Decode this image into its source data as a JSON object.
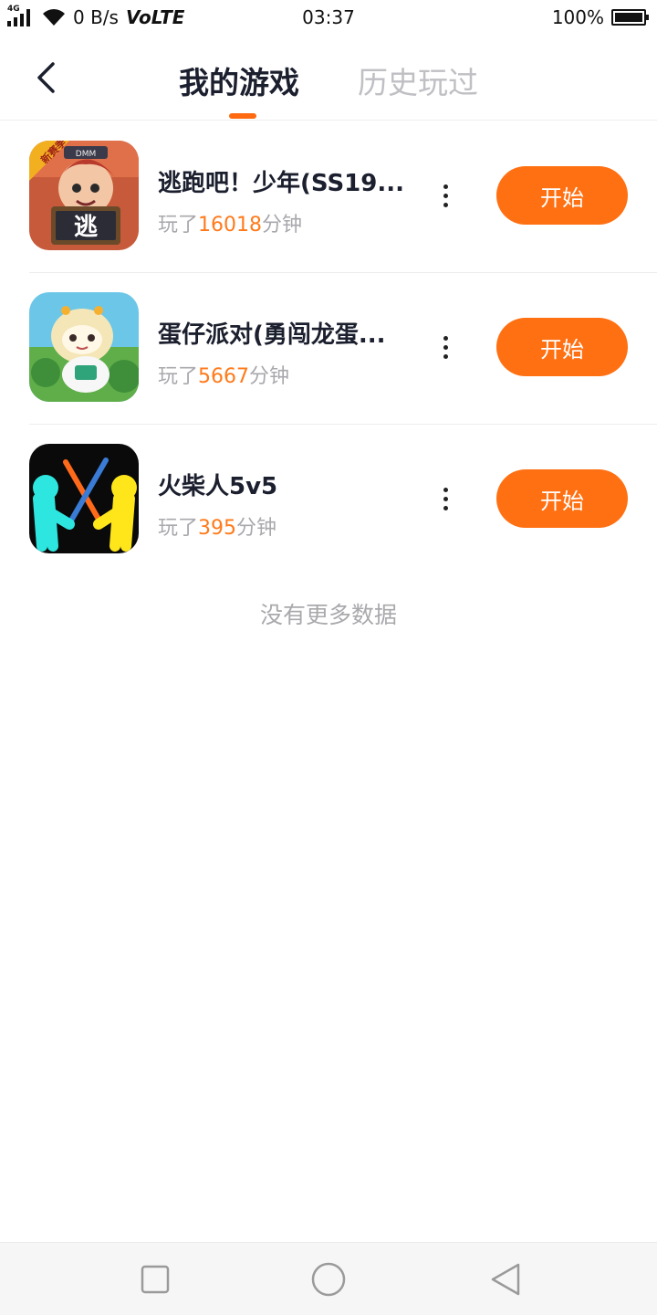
{
  "status_bar": {
    "network_speed": "0 B/s",
    "volte": "VoLTE",
    "network_type": "4G",
    "time": "03:37",
    "battery": "100%"
  },
  "header": {
    "tabs": [
      {
        "label": "我的游戏",
        "active": true
      },
      {
        "label": "历史玩过",
        "active": false
      }
    ],
    "accent_color": "#ff6a10"
  },
  "games": [
    {
      "title": "逃跑吧！少年(SS19...",
      "played_prefix": "玩了",
      "minutes": "16018",
      "played_suffix": "分钟",
      "action": "开始",
      "icon": "escape-game-icon"
    },
    {
      "title": "蛋仔派对(勇闯龙蛋...",
      "played_prefix": "玩了",
      "minutes": "5667",
      "played_suffix": "分钟",
      "action": "开始",
      "icon": "eggy-party-icon"
    },
    {
      "title": "火柴人5v5",
      "played_prefix": "玩了",
      "minutes": "395",
      "played_suffix": "分钟",
      "action": "开始",
      "icon": "stickman-icon"
    }
  ],
  "icon_texts": {
    "badge": "新赛季",
    "sign": "逃",
    "cap": "DMM"
  },
  "footer_text": "没有更多数据",
  "colors": {
    "primary": "#ff7012",
    "highlight_number": "#ff7a1a",
    "muted_text": "#a8a8ad",
    "title_text": "#1b1f2e"
  }
}
